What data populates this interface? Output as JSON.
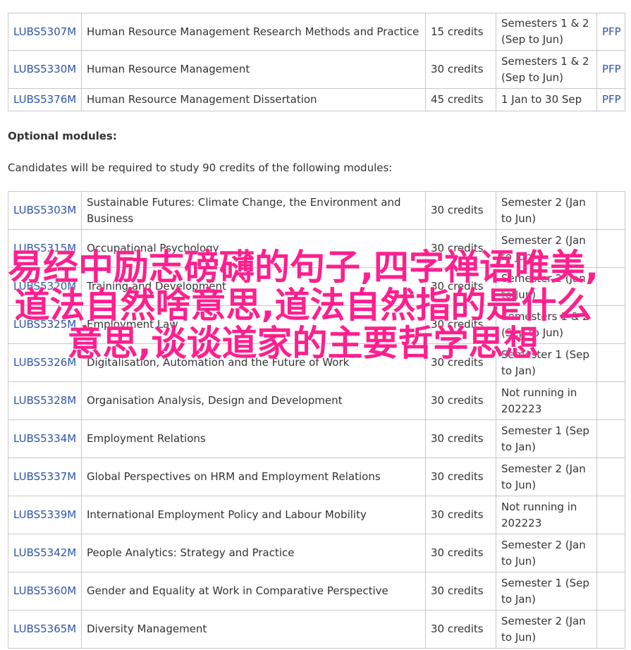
{
  "core_modules": [
    {
      "code": "LUBS5307M",
      "title": "Human Resource Management Research Methods and Practice",
      "credits": "15 credits",
      "semester": "Semesters 1 & 2 (Sep to Jun)",
      "link": "PFP"
    },
    {
      "code": "LUBS5330M",
      "title": "Human Resource Management",
      "credits": "30 credits",
      "semester": "Semesters 1 & 2 (Sep to Jun)",
      "link": "PFP"
    },
    {
      "code": "LUBS5376M",
      "title": "Human Resource Management Dissertation",
      "credits": "45 credits",
      "semester": "1 Jan to 30 Sep",
      "link": "PFP"
    }
  ],
  "optional": {
    "heading": "Optional modules:",
    "intro": "Candidates will be required to study 90 credits of the following modules:",
    "modules": [
      {
        "code": "LUBS5303M",
        "title": "Sustainable Futures: Climate Change, the Environment and Business",
        "credits": "30 credits",
        "semester": "Semester 2 (Jan to Jun)"
      },
      {
        "code": "LUBS5315M",
        "title": "Occupational Psychology",
        "credits": "30 credits",
        "semester": "Semester 2 (Jan to Jun)"
      },
      {
        "code": "LUBS5320M",
        "title": "Training and Development",
        "credits": "30 credits",
        "semester": "Semester 2 (Jan to Jun)"
      },
      {
        "code": "LUBS5325M",
        "title": "Employment Law",
        "credits": "30 credits",
        "semester": "Semesters 1 & 2 (Sep to Jun)"
      },
      {
        "code": "LUBS5326M",
        "title": "Digitalisation, Automation and the Future of Work",
        "credits": "30 credits",
        "semester": "Semester 1 (Sep to Jan)"
      },
      {
        "code": "LUBS5328M",
        "title": "Organisation Analysis, Design and Development",
        "credits": "30 credits",
        "semester": "Not running in 202223"
      },
      {
        "code": "LUBS5334M",
        "title": "Employment Relations",
        "credits": "30 credits",
        "semester": "Semester 1 (Sep to Jan)"
      },
      {
        "code": "LUBS5337M",
        "title": "Global Perspectives on HRM and Employment Relations",
        "credits": "30 credits",
        "semester": "Semester 2 (Jan to Jun)"
      },
      {
        "code": "LUBS5339M",
        "title": "International Employment Policy and Labour Mobility",
        "credits": "30 credits",
        "semester": "Not running in 202223"
      },
      {
        "code": "LUBS5342M",
        "title": "People Analytics: Strategy and Practice",
        "credits": "30 credits",
        "semester": "Semester 2 (Jan to Jun)"
      },
      {
        "code": "LUBS5360M",
        "title": "Gender and Equality at Work in Comparative Perspective",
        "credits": "30 credits",
        "semester": "Semester 1 (Sep to Jan)"
      },
      {
        "code": "LUBS5365M",
        "title": "Diversity Management",
        "credits": "30 credits",
        "semester": "Semester 2 (Jan to Jun)"
      }
    ]
  },
  "overlay_text": "易经中励志磅礴的句子,四字禅语唯美,道法自然啥意思,道法自然指的是什么意思,谈谈道家的主要哲学思想",
  "colors": {
    "link": "#2e55a8",
    "overlay": "#ff1f8e",
    "border": "#c8c8c8",
    "text": "#333333"
  }
}
